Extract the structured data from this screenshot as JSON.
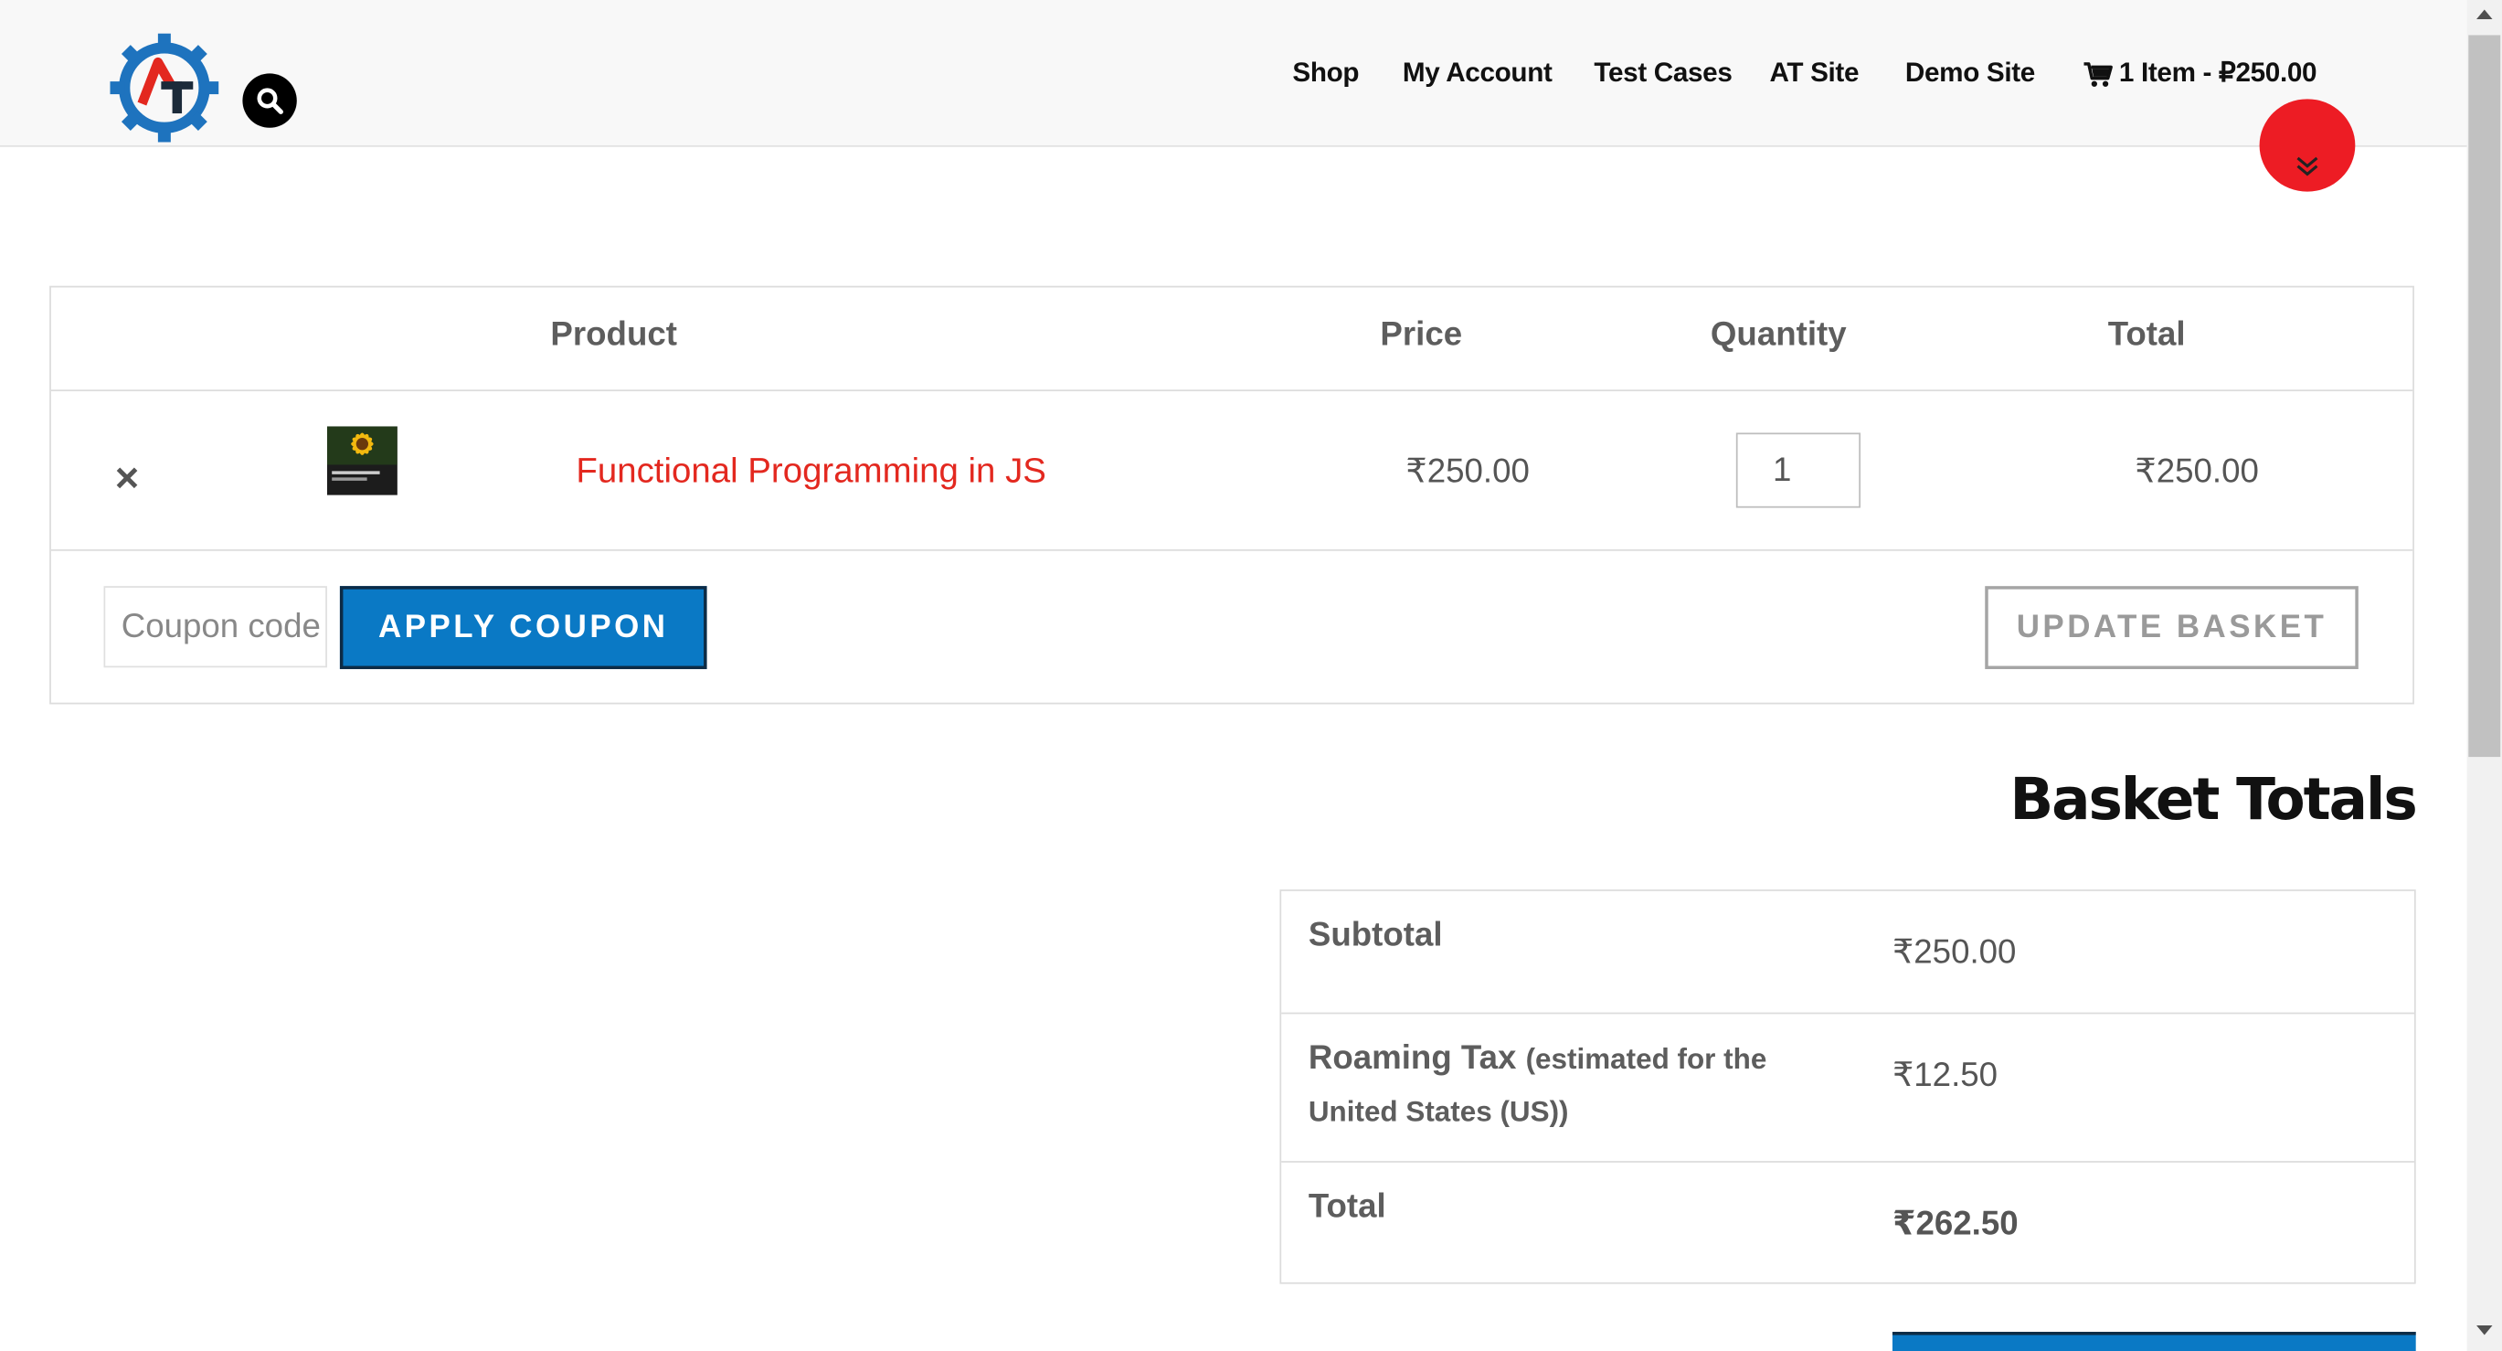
{
  "header": {
    "nav": [
      {
        "label": "Shop"
      },
      {
        "label": "My Account"
      },
      {
        "label": "Test Cases"
      },
      {
        "label": "AT Site"
      },
      {
        "label": "Demo Site"
      }
    ],
    "cart_label": "1 Item - ₽250.00",
    "logo_letters": "AT"
  },
  "cart": {
    "headers": {
      "product": "Product",
      "price": "Price",
      "quantity": "Quantity",
      "total": "Total"
    },
    "items": [
      {
        "remove_symbol": "×",
        "name": "Functional Programming in JS",
        "price": "₹250.00",
        "quantity": "1",
        "total": "₹250.00"
      }
    ],
    "coupon_placeholder": "Coupon code",
    "apply_coupon_label": "APPLY COUPON",
    "update_basket_label": "UPDATE BASKET"
  },
  "totals": {
    "title": "Basket Totals",
    "subtotal_label": "Subtotal",
    "subtotal_value": "₹250.00",
    "tax_label": "Roaming Tax",
    "tax_note_line1": "(estimated for the",
    "tax_note_line2": "United States (US))",
    "tax_value": "₹12.50",
    "total_label": "Total",
    "total_value": "₹262.50"
  },
  "colors": {
    "accent_blue": "#0a79c5",
    "link_red": "#e3281f",
    "badge_red": "#ed1c24"
  },
  "icons": [
    "logo-gear-icon",
    "search-icon",
    "cart-icon",
    "chevron-double-down-icon",
    "remove-icon"
  ]
}
